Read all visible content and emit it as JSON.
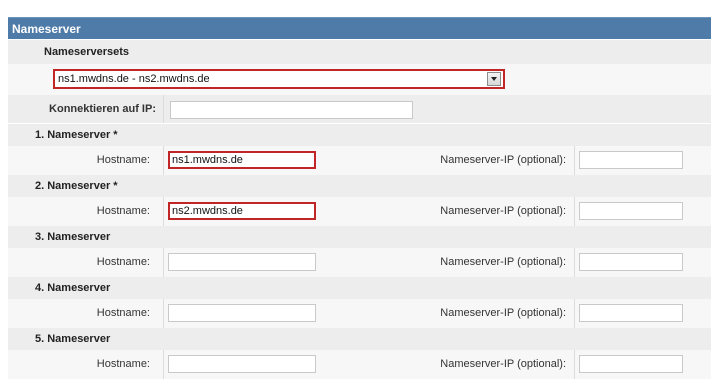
{
  "header": {
    "title": "Nameserver"
  },
  "sets": {
    "label": "Nameserversets",
    "selected": "ns1.mwdns.de - ns2.mwdns.de"
  },
  "connect": {
    "label": "Konnektieren auf IP:",
    "value": ""
  },
  "nameservers": [
    {
      "title": "1. Nameserver *",
      "hostname_label": "Hostname:",
      "hostname": "ns1.mwdns.de",
      "ip_label": "Nameserver-IP (optional):",
      "ip": ""
    },
    {
      "title": "2. Nameserver *",
      "hostname_label": "Hostname:",
      "hostname": "ns2.mwdns.de",
      "ip_label": "Nameserver-IP (optional):",
      "ip": ""
    },
    {
      "title": "3. Nameserver",
      "hostname_label": "Hostname:",
      "hostname": "",
      "ip_label": "Nameserver-IP (optional):",
      "ip": ""
    },
    {
      "title": "4. Nameserver",
      "hostname_label": "Hostname:",
      "hostname": "",
      "ip_label": "Nameserver-IP (optional):",
      "ip": ""
    },
    {
      "title": "5. Nameserver",
      "hostname_label": "Hostname:",
      "hostname": "",
      "ip_label": "Nameserver-IP (optional):",
      "ip": ""
    }
  ],
  "colors": {
    "header": "#4f7ba8",
    "highlight": "#c02626",
    "row_shade": "#ededed"
  }
}
